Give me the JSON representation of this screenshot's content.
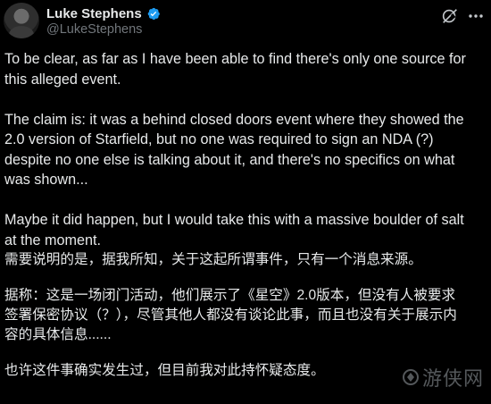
{
  "author": {
    "display_name": "Luke Stephens",
    "handle": "@LukeStephens",
    "verified": true
  },
  "icons": {
    "avatar": "avatar",
    "verified": "verified-badge-icon",
    "grok": "grok-icon",
    "more": "more-options-icon"
  },
  "colors": {
    "background": "#000000",
    "text": "#e7e9ea",
    "muted": "#71767b",
    "verified": "#1d9bf0"
  },
  "tweet": {
    "en": {
      "p1_l1": "To be clear, as far as I have been able to find there's only one source for",
      "p1_l2": "this alleged event.",
      "p2_l1": "The claim is: it was a behind closed doors event where they showed the",
      "p2_l2": "2.0 version of Starfield, but no one was required to sign an NDA (?)",
      "p2_l3": "despite no one else is talking about it, and there's no specifics on what",
      "p2_l4": "was shown...",
      "p3_l1": "Maybe it did happen, but I would take this with a massive boulder of salt",
      "p3_l2": "at the moment."
    },
    "zh": {
      "p1_l1": "需要说明的是，据我所知，关于这起所谓事件，只有一个消息来源。",
      "p2_l1": "据称：这是一场闭门活动，他们展示了《星空》2.0版本，但没有人被要求",
      "p2_l2": "签署保密协议（？），尽管其他人都没有谈论此事，而且也没有关于展示内",
      "p2_l3": "容的具体信息......",
      "p3_l1": "也许这件事确实发生过，但目前我对此持怀疑态度。"
    }
  },
  "watermark": {
    "text": "游侠网"
  }
}
